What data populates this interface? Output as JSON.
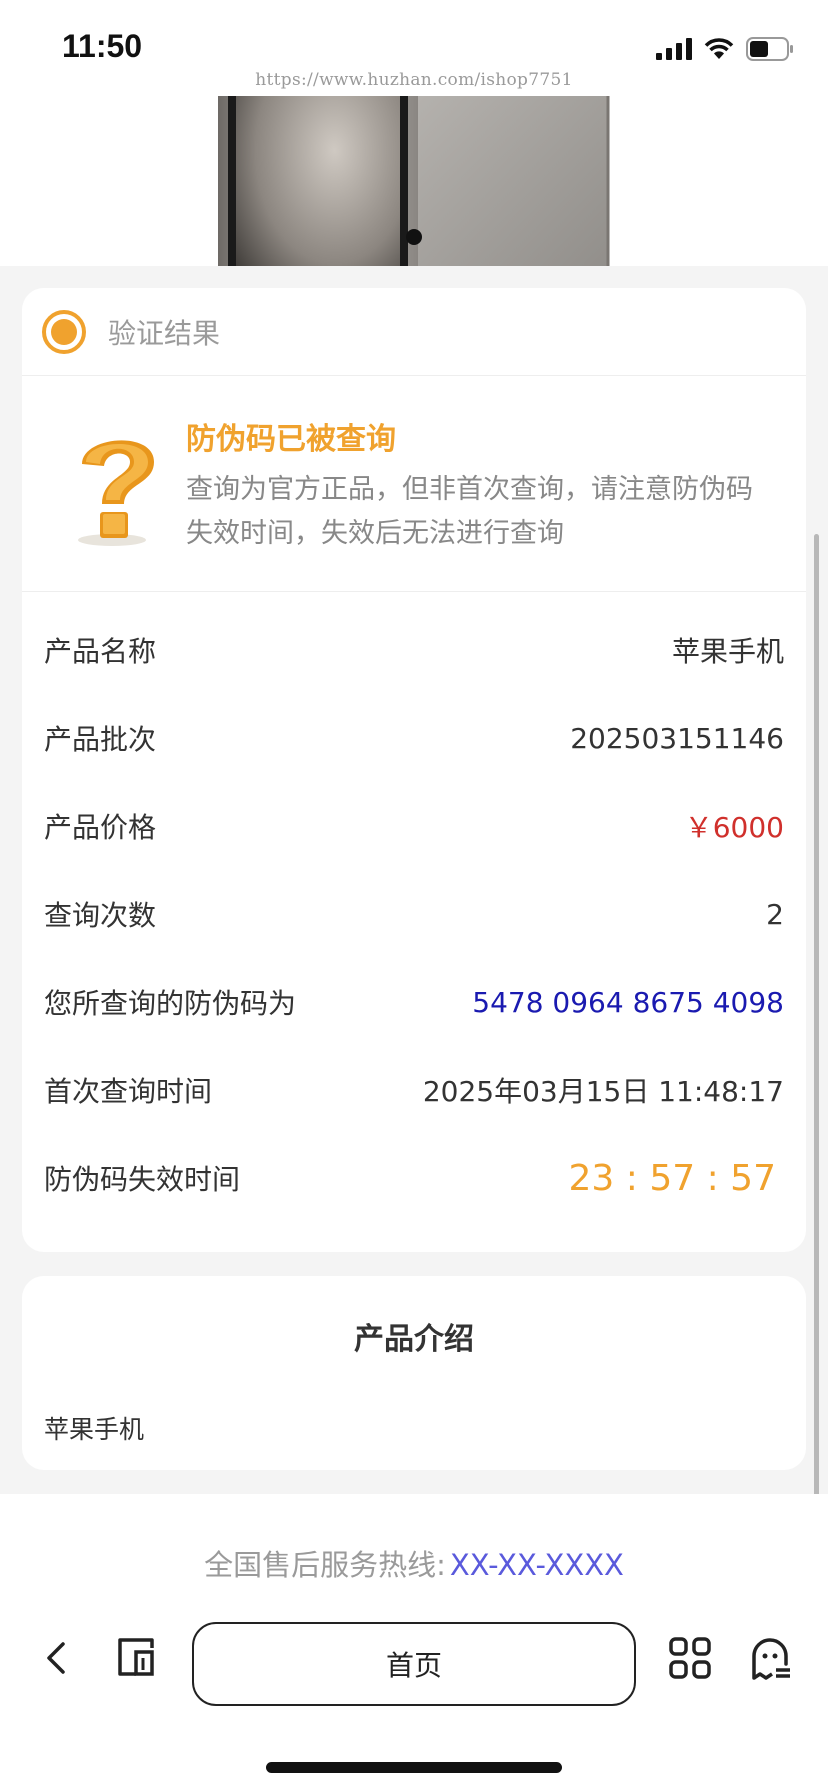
{
  "status_bar": {
    "time": "11:50",
    "icons": [
      "signal-icon",
      "wifi-icon",
      "battery-icon"
    ]
  },
  "watermark": "https://www.huzhan.com/ishop7751",
  "result": {
    "header_label": "验证结果",
    "alert_title": "防伪码已被查询",
    "alert_text": "查询为官方正品，但非首次查询，请注意防伪码失效时间，失效后无法进行查询",
    "rows": [
      {
        "label": "产品名称",
        "value": "苹果手机"
      },
      {
        "label": "产品批次",
        "value": "202503151146"
      },
      {
        "label": "产品价格",
        "value": "￥6000"
      },
      {
        "label": "查询次数",
        "value": "2"
      },
      {
        "label": "您所查询的防伪码为",
        "value": "5478 0964 8675 4098"
      },
      {
        "label": "首次查询时间",
        "value": "2025年03月15日 11:48:17"
      },
      {
        "label": "防伪码失效时间",
        "value": "23 : 57 : 57"
      }
    ]
  },
  "intro": {
    "title": "产品介绍",
    "body": "苹果手机"
  },
  "hotline": {
    "label": "全国售后服务热线:",
    "number": "XX-XX-XXXX"
  },
  "browser": {
    "home_label": "首页"
  },
  "colors": {
    "accent": "#f0a22e",
    "price": "#d0302c",
    "code": "#1a1ab0",
    "hotline": "#5a5adc"
  }
}
